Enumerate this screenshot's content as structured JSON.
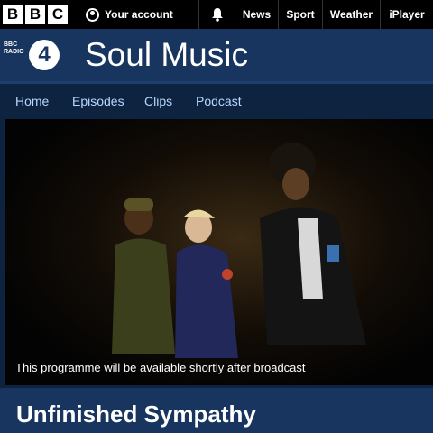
{
  "topbar": {
    "logo_letters": [
      "B",
      "B",
      "C"
    ],
    "account_label": "Your account",
    "nav": [
      "News",
      "Sport",
      "Weather",
      "iPlayer"
    ]
  },
  "header": {
    "station_small": "BBC RADIO",
    "station_number": "4",
    "title": "Soul Music"
  },
  "subnav": {
    "tabs": [
      "Home",
      "Episodes",
      "Clips",
      "Podcast"
    ]
  },
  "hero": {
    "caption": "This programme will be available shortly after broadcast"
  },
  "episode": {
    "title": "Unfinished Sympathy"
  },
  "colors": {
    "header_bg": "#17355f",
    "page_bg": "#0d2340",
    "tab_text": "#b7d7ff",
    "topbar_bg": "#000000"
  }
}
